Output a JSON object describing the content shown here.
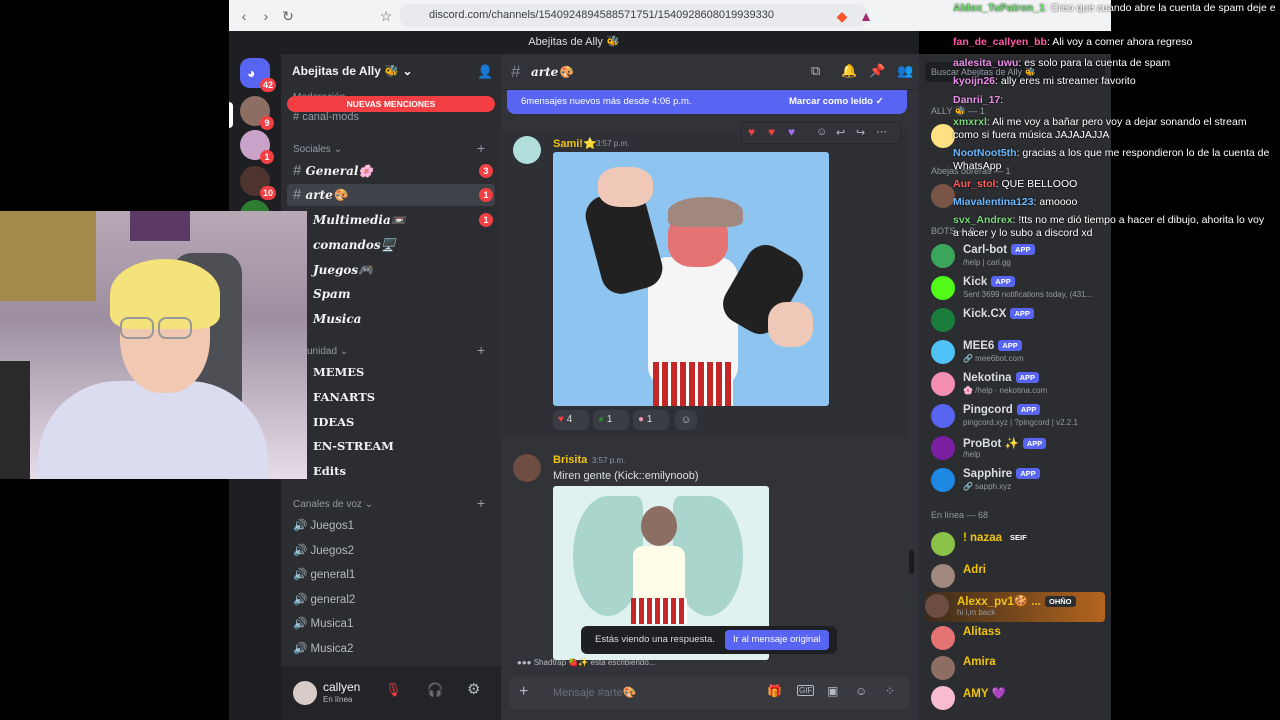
{
  "browser": {
    "url": "discord.com/channels/1540924894588571751/1540928608019939330"
  },
  "window": {
    "title": "Abejitas de Ally 🐝"
  },
  "servers": {
    "home_badge": "42",
    "badges": [
      "9",
      "1",
      "10"
    ]
  },
  "sidebar": {
    "server_name": "Abejitas de Ally 🐝",
    "new_mentions": "NUEVAS MENCIONES",
    "mod_category": "Moderación",
    "mod_channel": "canal-mods",
    "social_category": "Sociales",
    "channels": [
      {
        "name": "General🌸",
        "badge": "3"
      },
      {
        "name": "arte🎨",
        "badge": "1"
      },
      {
        "name": "Multimedia📼",
        "badge": "1"
      },
      {
        "name": "comandos🖥️",
        "badge": ""
      },
      {
        "name": "Juegos🎮",
        "badge": ""
      },
      {
        "name": "Spam",
        "badge": ""
      },
      {
        "name": "Musica",
        "badge": ""
      }
    ],
    "community_category": "unidad",
    "community_channels": [
      "MEMES",
      "FANARTS",
      "IDEAS",
      "EN-STREAM",
      "Edits"
    ],
    "voice_category": "Canales de voz",
    "voice_channels": [
      "Juegos1",
      "Juegos2",
      "general1",
      "general2",
      "Musica1",
      "Musica2"
    ],
    "user": {
      "name": "callyen",
      "status": "En línea"
    }
  },
  "chat": {
    "channel": "arte🎨",
    "new_banner": "6mensajes nuevos más desde 4:06 p.m.",
    "mark_read": "Marcar como leído",
    "messages": [
      {
        "author": "Sami!⭐",
        "time": "3:57 p.m.",
        "reactions": [
          "4",
          "1",
          "1"
        ]
      },
      {
        "author": "Brisita",
        "time": "3:57 p.m.",
        "text": "Miren gente (Kick::emilynoob)"
      }
    ],
    "reply_notice": "Estás viendo una respuesta.",
    "reply_button": "Ir al mensaje original",
    "typing": "Shadtrap 🍓✨ está escribiendo...",
    "input_placeholder": "Mensaje #arte🎨",
    "search_placeholder": "Buscar Abejitas de Ally 🐝"
  },
  "members": {
    "group_ally": "ALLY 🐝 — 1",
    "group_abejas": "Abejas obreras — 1",
    "group_bots": "BOTS — 9",
    "bots": [
      {
        "name": "Carl-bot",
        "sub": "/help | carl.gg",
        "color": "#3ba55c"
      },
      {
        "name": "Kick",
        "sub": "Sent 3699 notifications today, (431...",
        "color": "#53fc18"
      },
      {
        "name": "Kick.CX",
        "sub": "",
        "color": "#1a7d3b"
      },
      {
        "name": "MEE6",
        "sub": "🔗 mee6bot.com",
        "color": "#4fc3f7"
      },
      {
        "name": "Nekotina",
        "sub": "🌸 /help · nekotina.com",
        "color": "#f48fb1"
      },
      {
        "name": "Pingcord",
        "sub": "pingcord.xyz | ?pingcord | v2.2.1",
        "color": "#5865f2"
      },
      {
        "name": "ProBot ✨",
        "sub": "/help",
        "color": "#7b1fa2"
      },
      {
        "name": "Sapphire",
        "sub": "🔗 sapph.xyz",
        "color": "#1e88e5"
      }
    ],
    "app_label": "APP",
    "group_online": "En línea — 68",
    "online": [
      {
        "name": "! nazaa",
        "tag": "SEIF",
        "color": "#f1c40f"
      },
      {
        "name": "Adri",
        "tag": "",
        "color": "#f1c40f"
      },
      {
        "name": "Alexx_pv1🍪 ...",
        "tag": "OHÑO",
        "sub": "hi i,m back",
        "color": "#f1c40f"
      },
      {
        "name": "Alitass",
        "tag": "",
        "color": "#f1c40f"
      },
      {
        "name": "Amira",
        "tag": "",
        "color": "#f1c40f"
      },
      {
        "name": "AMY 💜",
        "tag": "",
        "color": "#f1c40f"
      }
    ]
  },
  "stream_chat": [
    {
      "user": "Aldox_TuPatron_1",
      "color": "#6ee06e",
      "text": "Creo que cuando abre la cuenta de spam deje el link para el canal"
    },
    {
      "user": "fan_de_callyen_bb",
      "color": "#ff5aa5",
      "text": "Ali voy a comer ahora regreso"
    },
    {
      "user": "aalesita_uwu",
      "color": "#e88ee8",
      "text": "es solo para la cuenta de spam"
    },
    {
      "user": "kyoijn26",
      "color": "#e88ee8",
      "text": "ally eres mi streamer favorito"
    },
    {
      "user": "Danrii_17",
      "color": "#e88ee8",
      "text": ""
    },
    {
      "user": "xmxrxl",
      "color": "#7cd67c",
      "text": "Ali me voy a bañar pero voy a dejar sonando el stream como si fuera música JAJAJAJJA"
    },
    {
      "user": "NootNoot5th",
      "color": "#6ab8ff",
      "text": "gracias a los que me respondieron lo de la cuenta de WhatsApp"
    },
    {
      "user": "Aur_stol",
      "color": "#ff5a5a",
      "text": "QUE BELLOOO"
    },
    {
      "user": "Miavalentina123",
      "color": "#6ab8ff",
      "text": "amoooo"
    },
    {
      "user": "svx_Andrex",
      "color": "#7cd67c",
      "text": "!tts no me dió tiempo a hacer el dibujo, ahorita lo voy a hacer y lo subo a discord xd"
    }
  ]
}
